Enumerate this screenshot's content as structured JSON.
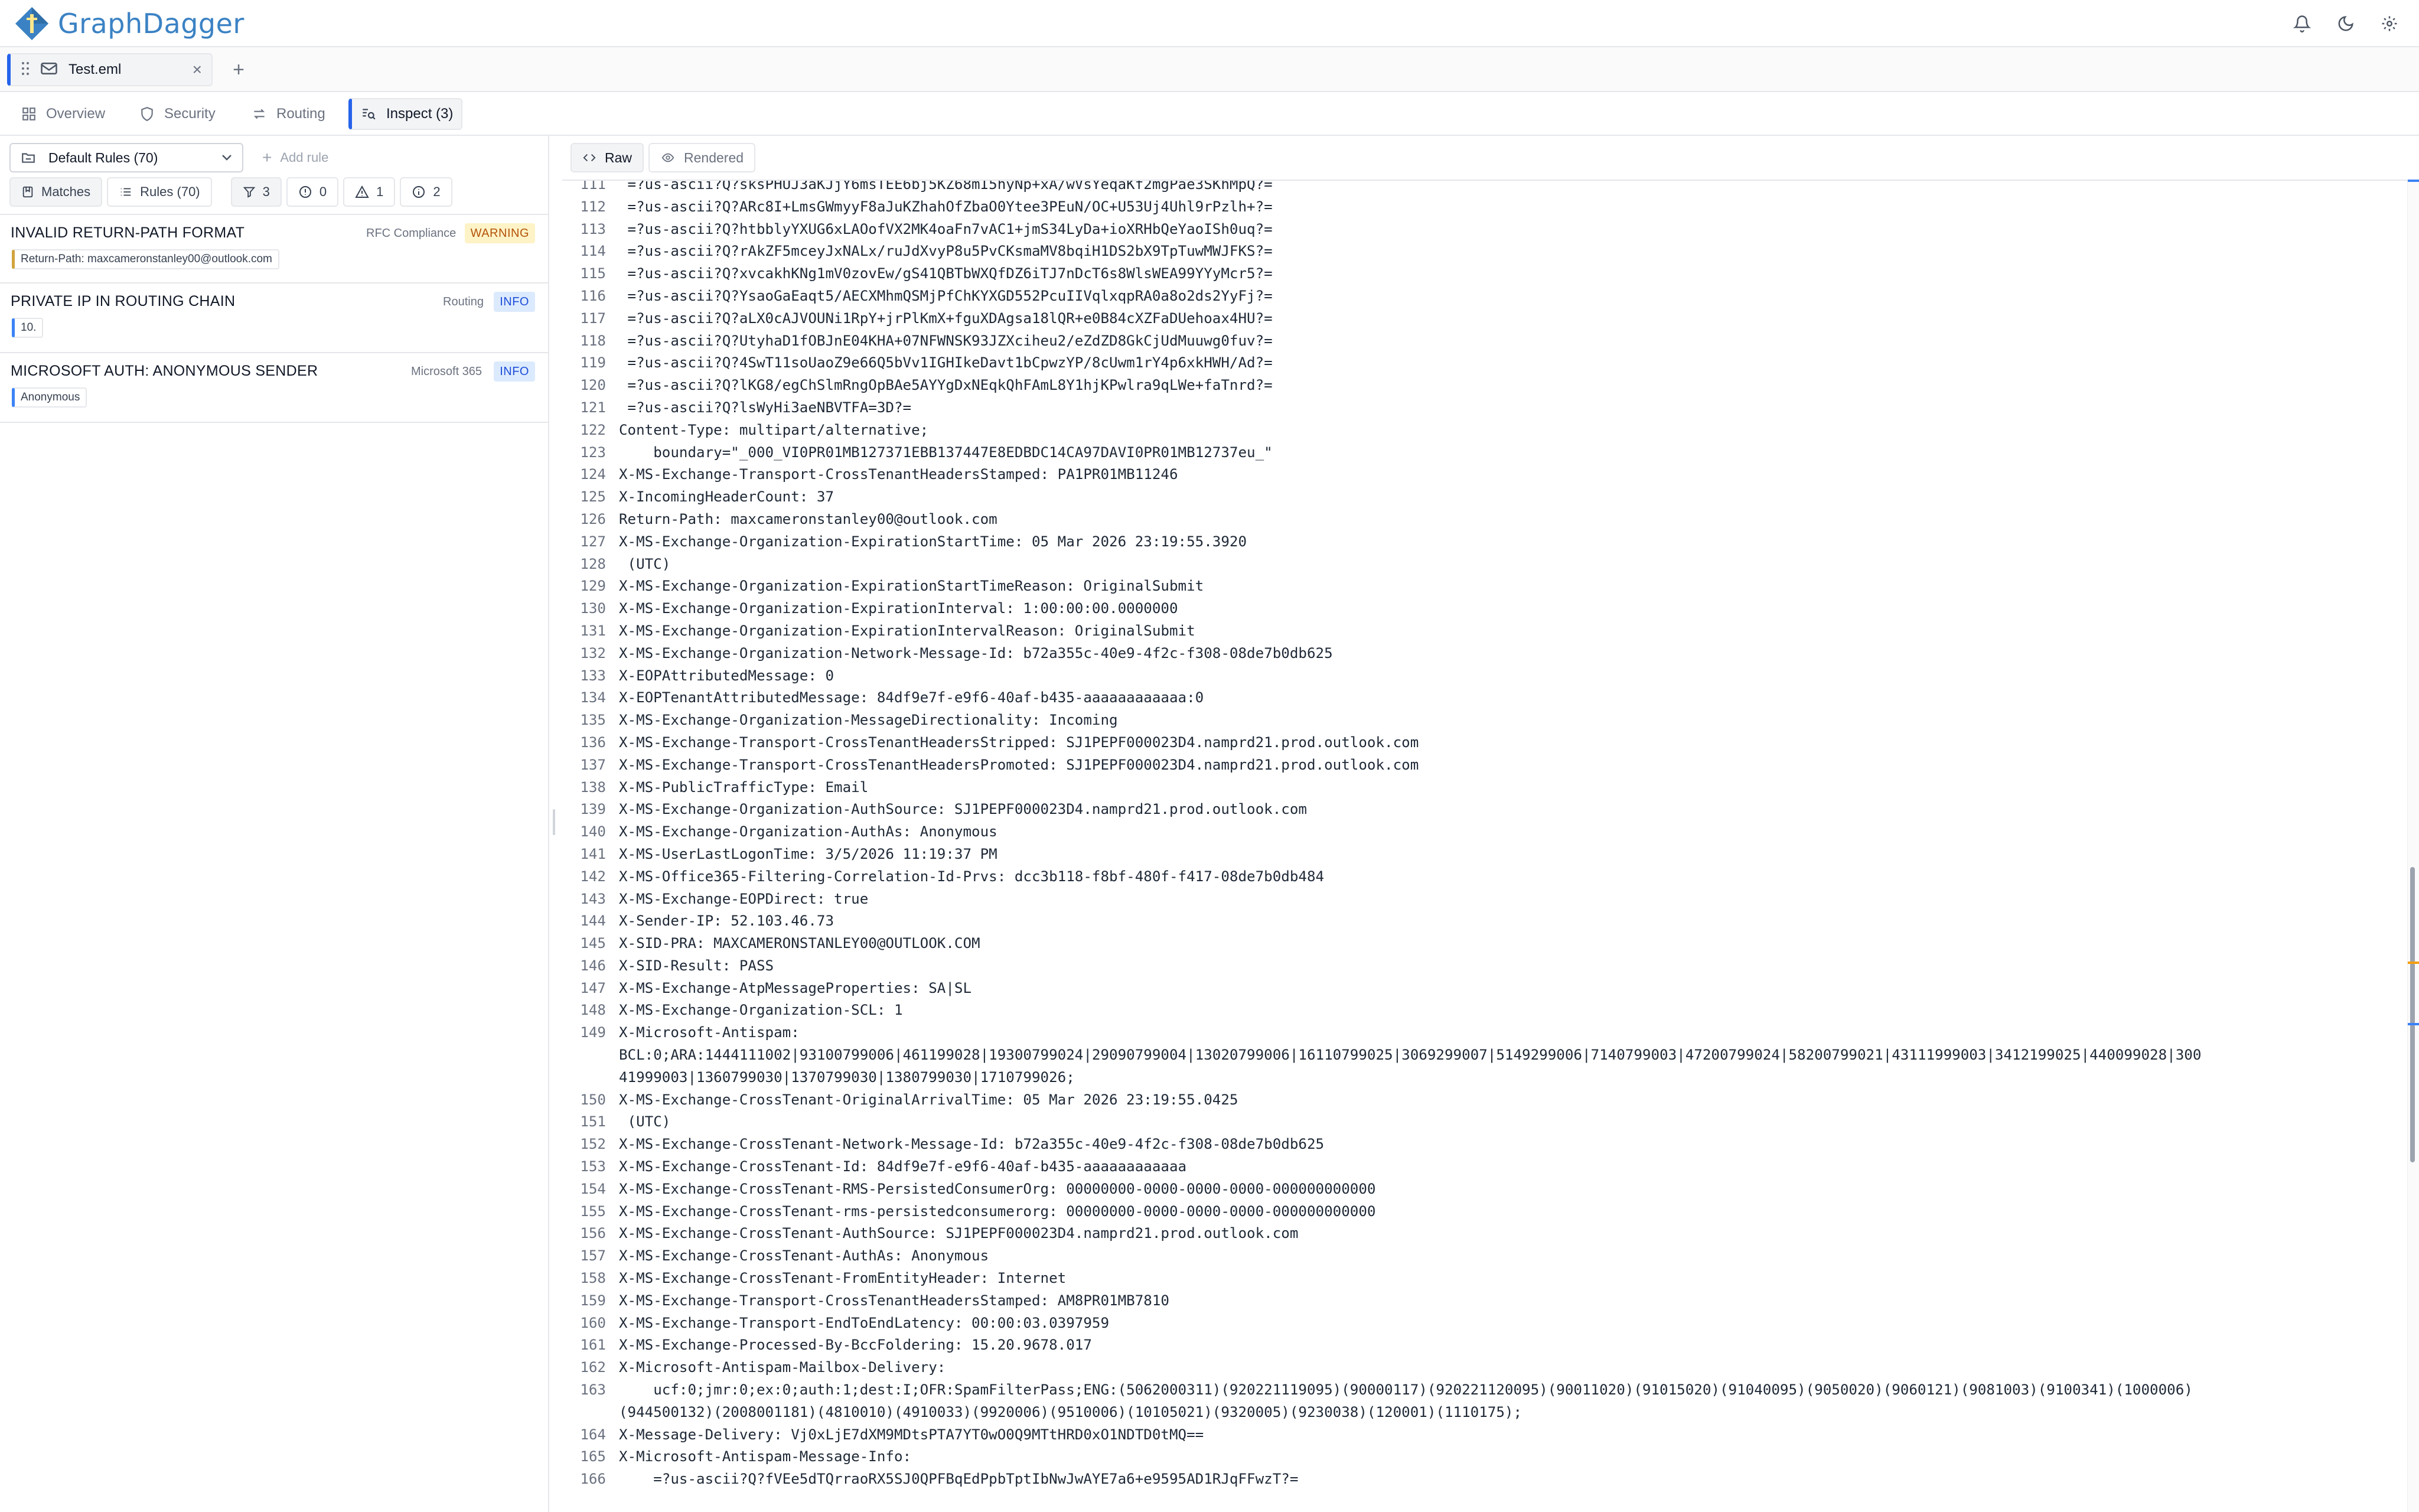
{
  "app": {
    "name": "GraphDagger"
  },
  "tab": {
    "filename": "Test.eml",
    "close": "×",
    "new_tab": "+"
  },
  "nav": {
    "overview": "Overview",
    "security": "Security",
    "routing": "Routing",
    "inspect": "Inspect (3)"
  },
  "rules": {
    "selected_set": "Default Rules (70)",
    "add_rule": "Add rule",
    "matches": "Matches",
    "rules_count": "Rules (70)",
    "filter_all": "3",
    "filter_errors": "0",
    "filter_warnings": "1",
    "filter_info": "2"
  },
  "findings": [
    {
      "title": "INVALID RETURN-PATH FORMAT",
      "category": "RFC Compliance",
      "severity": "WARNING",
      "evidence": "Return-Path: maxcameronstanley00@outlook.com"
    },
    {
      "title": "PRIVATE IP IN ROUTING CHAIN",
      "category": "Routing",
      "severity": "INFO",
      "evidence": "10."
    },
    {
      "title": "MICROSOFT AUTH: ANONYMOUS SENDER",
      "category": "Microsoft 365",
      "severity": "INFO",
      "evidence": "Anonymous"
    }
  ],
  "viewer": {
    "raw": "Raw",
    "rendered": "Rendered"
  },
  "colors": {
    "accent": "#2563eb",
    "warning": "#b45309",
    "info": "#1d4ed8",
    "brand": "#3b82c4"
  },
  "code_lines": [
    {
      "n": "111",
      "t": " =?us-ascii?Q?sksPHUJ3aKJjY6msTEE6bj5KZ68mI5hyNp+xA/wVsYeqaKf2mgPae3SKhMpQ?="
    },
    {
      "n": "112",
      "t": " =?us-ascii?Q?ARc8I+LmsGWmyyF8aJuKZhahOfZbaO0Ytee3PEuN/OC+U53Uj4Uhl9rPzlh+?="
    },
    {
      "n": "113",
      "t": " =?us-ascii?Q?htbblyYXUG6xLAOofVX2MK4oaFn7vAC1+jmS34LyDa+ioXRHbQeYaoISh0uq?="
    },
    {
      "n": "114",
      "t": " =?us-ascii?Q?rAkZF5mceyJxNALx/ruJdXvyP8u5PvCKsmaMV8bqiH1DS2bX9TpTuwMWJFKS?="
    },
    {
      "n": "115",
      "t": " =?us-ascii?Q?xvcakhKNg1mV0zovEw/gS41QBTbWXQfDZ6iTJ7nDcT6s8WlsWEA99YYyMcr5?="
    },
    {
      "n": "116",
      "t": " =?us-ascii?Q?YsaoGaEaqt5/AECXMhmQSMjPfChKYXGD552PcuIIVqlxqpRA0a8o2ds2YyFj?="
    },
    {
      "n": "117",
      "t": " =?us-ascii?Q?aLX0cAJVOUNi1RpY+jrPlKmX+fguXDAgsa18lQR+e0B84cXZFaDUehoax4HU?="
    },
    {
      "n": "118",
      "t": " =?us-ascii?Q?UtyhaD1fOBJnE04KHA+07NFWNSK93JZXciheu2/eZdZD8GkCjUdMuuwg0fuv?="
    },
    {
      "n": "119",
      "t": " =?us-ascii?Q?4SwT11soUaoZ9e66Q5bVv1IGHIkeDavt1bCpwzYP/8cUwm1rY4p6xkHWH/Ad?="
    },
    {
      "n": "120",
      "t": " =?us-ascii?Q?lKG8/egChSlmRngOpBAe5AYYgDxNEqkQhFAmL8Y1hjKPwlra9qLWe+faTnrd?="
    },
    {
      "n": "121",
      "t": " =?us-ascii?Q?lsWyHi3aeNBVTFA=3D?="
    },
    {
      "n": "122",
      "t": "Content-Type: multipart/alternative;"
    },
    {
      "n": "123",
      "t": "    boundary=\"_000_VI0PR01MB127371EBB137447E8EDBDC14CA97DAVI0PR01MB12737eu_\""
    },
    {
      "n": "124",
      "t": "X-MS-Exchange-Transport-CrossTenantHeadersStamped: PA1PR01MB11246"
    },
    {
      "n": "125",
      "t": "X-IncomingHeaderCount: 37"
    },
    {
      "n": "126",
      "t": "Return-Path: maxcameronstanley00@outlook.com"
    },
    {
      "n": "127",
      "t": "X-MS-Exchange-Organization-ExpirationStartTime: 05 Mar 2026 23:19:55.3920"
    },
    {
      "n": "128",
      "t": " (UTC)"
    },
    {
      "n": "129",
      "t": "X-MS-Exchange-Organization-ExpirationStartTimeReason: OriginalSubmit"
    },
    {
      "n": "130",
      "t": "X-MS-Exchange-Organization-ExpirationInterval: 1:00:00:00.0000000"
    },
    {
      "n": "131",
      "t": "X-MS-Exchange-Organization-ExpirationIntervalReason: OriginalSubmit"
    },
    {
      "n": "132",
      "t": "X-MS-Exchange-Organization-Network-Message-Id: b72a355c-40e9-4f2c-f308-08de7b0db625"
    },
    {
      "n": "133",
      "t": "X-EOPAttributedMessage: 0"
    },
    {
      "n": "134",
      "t": "X-EOPTenantAttributedMessage: 84df9e7f-e9f6-40af-b435-aaaaaaaaaaaa:0"
    },
    {
      "n": "135",
      "t": "X-MS-Exchange-Organization-MessageDirectionality: Incoming"
    },
    {
      "n": "136",
      "t": "X-MS-Exchange-Transport-CrossTenantHeadersStripped: SJ1PEPF000023D4.namprd21.prod.outlook.com"
    },
    {
      "n": "137",
      "t": "X-MS-Exchange-Transport-CrossTenantHeadersPromoted: SJ1PEPF000023D4.namprd21.prod.outlook.com"
    },
    {
      "n": "138",
      "t": "X-MS-PublicTrafficType: Email"
    },
    {
      "n": "139",
      "t": "X-MS-Exchange-Organization-AuthSource: SJ1PEPF000023D4.namprd21.prod.outlook.com"
    },
    {
      "n": "140",
      "t": "X-MS-Exchange-Organization-AuthAs: Anonymous"
    },
    {
      "n": "141",
      "t": "X-MS-UserLastLogonTime: 3/5/2026 11:19:37 PM"
    },
    {
      "n": "142",
      "t": "X-MS-Office365-Filtering-Correlation-Id-Prvs: dcc3b118-f8bf-480f-f417-08de7b0db484"
    },
    {
      "n": "143",
      "t": "X-MS-Exchange-EOPDirect: true"
    },
    {
      "n": "144",
      "t": "X-Sender-IP: 52.103.46.73"
    },
    {
      "n": "145",
      "t": "X-SID-PRA: MAXCAMERONSTANLEY00@OUTLOOK.COM"
    },
    {
      "n": "146",
      "t": "X-SID-Result: PASS"
    },
    {
      "n": "147",
      "t": "X-MS-Exchange-AtpMessageProperties: SA|SL"
    },
    {
      "n": "148",
      "t": "X-MS-Exchange-Organization-SCL: 1"
    },
    {
      "n": "149",
      "t": "X-Microsoft-Antispam:"
    },
    {
      "n": "",
      "t": "BCL:0;ARA:1444111002|93100799006|461199028|19300799024|29090799004|13020799006|16110799025|3069299007|5149299006|7140799003|47200799024|58200799021|43111999003|3412199025|440099028|300"
    },
    {
      "n": "",
      "t": "41999003|1360799030|1370799030|1380799030|1710799026;"
    },
    {
      "n": "150",
      "t": "X-MS-Exchange-CrossTenant-OriginalArrivalTime: 05 Mar 2026 23:19:55.0425"
    },
    {
      "n": "151",
      "t": " (UTC)"
    },
    {
      "n": "152",
      "t": "X-MS-Exchange-CrossTenant-Network-Message-Id: b72a355c-40e9-4f2c-f308-08de7b0db625"
    },
    {
      "n": "153",
      "t": "X-MS-Exchange-CrossTenant-Id: 84df9e7f-e9f6-40af-b435-aaaaaaaaaaaa"
    },
    {
      "n": "154",
      "t": "X-MS-Exchange-CrossTenant-RMS-PersistedConsumerOrg: 00000000-0000-0000-0000-000000000000"
    },
    {
      "n": "155",
      "t": "X-MS-Exchange-CrossTenant-rms-persistedconsumerorg: 00000000-0000-0000-0000-000000000000"
    },
    {
      "n": "156",
      "t": "X-MS-Exchange-CrossTenant-AuthSource: SJ1PEPF000023D4.namprd21.prod.outlook.com"
    },
    {
      "n": "157",
      "t": "X-MS-Exchange-CrossTenant-AuthAs: Anonymous"
    },
    {
      "n": "158",
      "t": "X-MS-Exchange-CrossTenant-FromEntityHeader: Internet"
    },
    {
      "n": "159",
      "t": "X-MS-Exchange-Transport-CrossTenantHeadersStamped: AM8PR01MB7810"
    },
    {
      "n": "160",
      "t": "X-MS-Exchange-Transport-EndToEndLatency: 00:00:03.0397959"
    },
    {
      "n": "161",
      "t": "X-MS-Exchange-Processed-By-BccFoldering: 15.20.9678.017"
    },
    {
      "n": "162",
      "t": "X-Microsoft-Antispam-Mailbox-Delivery:"
    },
    {
      "n": "163",
      "t": "    ucf:0;jmr:0;ex:0;auth:1;dest:I;OFR:SpamFilterPass;ENG:(5062000311)(920221119095)(90000117)(920221120095)(90011020)(91015020)(91040095)(9050020)(9060121)(9081003)(9100341)(1000006)"
    },
    {
      "n": "",
      "t": "(944500132)(2008001181)(4810010)(4910033)(9920006)(9510006)(10105021)(9320005)(9230038)(120001)(1110175);"
    },
    {
      "n": "164",
      "t": "X-Message-Delivery: Vj0xLjE7dXM9MDtsPTA7YT0wO0Q9MTtHRD0xO1NDTD0tMQ=="
    },
    {
      "n": "165",
      "t": "X-Microsoft-Antispam-Message-Info:"
    },
    {
      "n": "166",
      "t": "    =?us-ascii?Q?fVEe5dTQrraoRX5SJ0QPFBqEdPpbTptIbNwJwAYE7a6+e9595AD1RJqFFwzT?="
    }
  ]
}
